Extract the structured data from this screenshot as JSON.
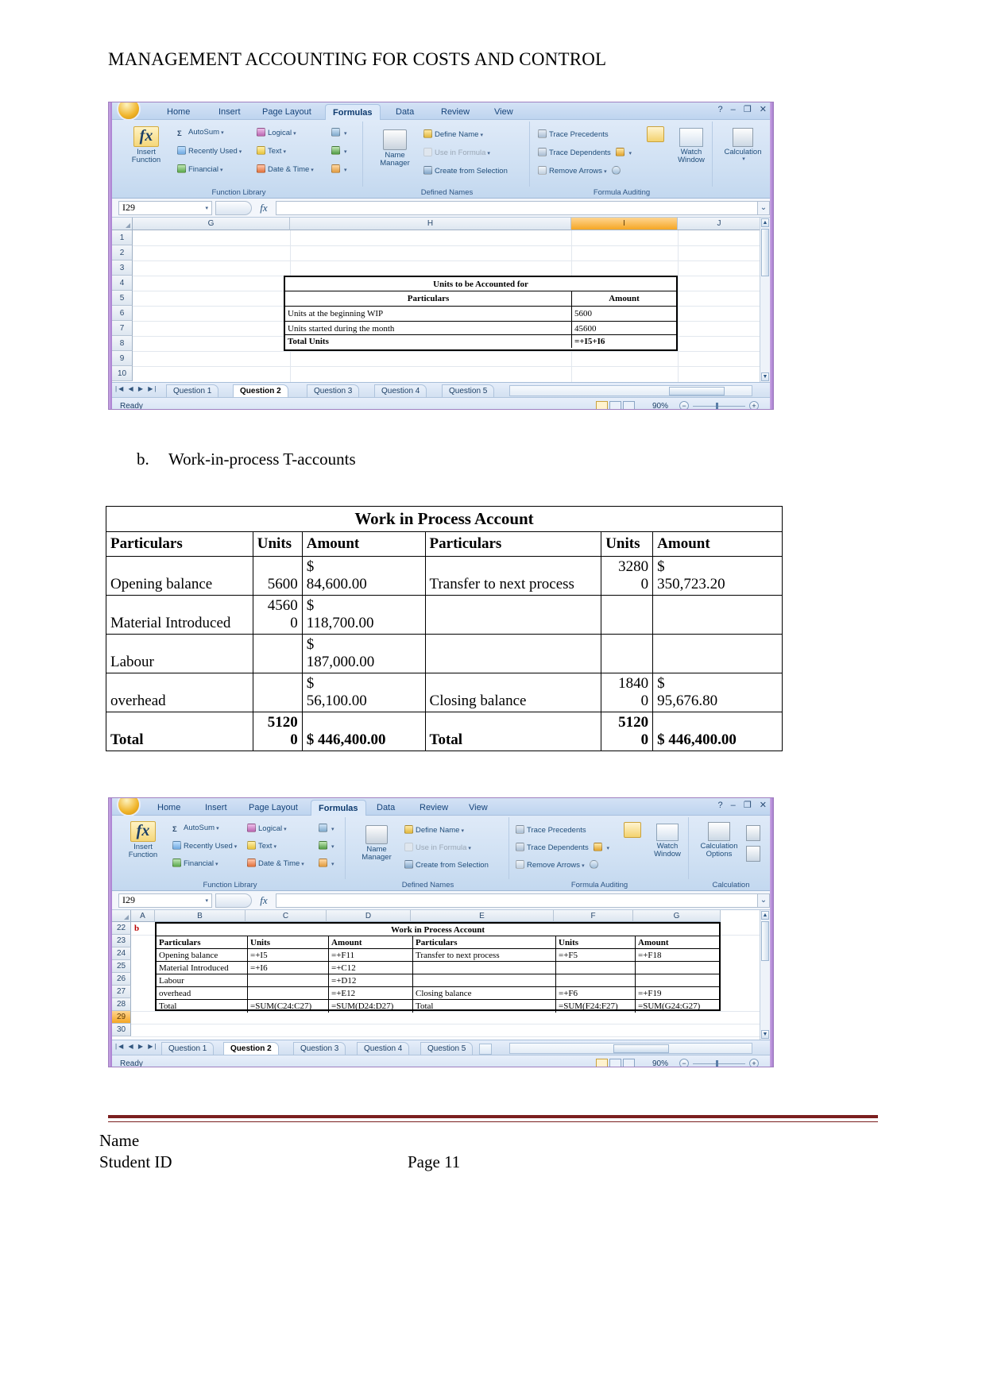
{
  "document": {
    "header": "MANAGEMENT ACCOUNTING FOR COSTS AND CONTROL",
    "list_item_b": {
      "marker": "b.",
      "text": "Work-in-process T-accounts"
    },
    "footer": {
      "name": "Name",
      "student_id": "Student ID",
      "page": "Page 11"
    }
  },
  "excel_top": {
    "ribbon_tabs": [
      "Home",
      "Insert",
      "Page Layout",
      "Formulas",
      "Data",
      "Review",
      "View"
    ],
    "active_ribbon_tab": "Formulas",
    "window_buttons": {
      "help": "?",
      "minimize": "–",
      "restore": "❐",
      "close": "✕"
    },
    "groups": {
      "function_library": {
        "label": "Function Library",
        "insert_function": "Insert\nFunction",
        "insert_function_line1": "Insert",
        "insert_function_line2": "Function",
        "fx": "fx",
        "items": [
          "AutoSum",
          "Recently Used",
          "Financial",
          "Logical",
          "Text",
          "Date & Time"
        ]
      },
      "defined_names": {
        "label": "Defined Names",
        "name_manager_line1": "Name",
        "name_manager_line2": "Manager",
        "items": [
          "Define Name",
          "Use in Formula",
          "Create from Selection"
        ]
      },
      "formula_auditing": {
        "label": "Formula Auditing",
        "items": [
          "Trace Precedents",
          "Trace Dependents",
          "Remove Arrows"
        ],
        "watch_window_line1": "Watch",
        "watch_window_line2": "Window"
      },
      "calculation": {
        "label": "Calculation",
        "calculation_line1": "Calculation"
      }
    },
    "name_box": "I29",
    "formula_bar_value": "",
    "columns": [
      "G",
      "H",
      "I",
      "J"
    ],
    "selected_column": "I",
    "rows": [
      "1",
      "2",
      "3",
      "4",
      "5",
      "6",
      "7",
      "8",
      "9",
      "10"
    ],
    "sheet_table": {
      "title": "Units to be Accounted for",
      "headers": [
        "Particulars",
        "Amount"
      ],
      "rows": [
        {
          "particulars": "Units at the beginning WIP",
          "amount": "5600"
        },
        {
          "particulars": "Units started during the month",
          "amount": "45600"
        },
        {
          "particulars": "Total Units",
          "amount": "=+I5+I6"
        }
      ]
    },
    "sheet_tabs": [
      "Question 1",
      "Question 2",
      "Question 3",
      "Question 4",
      "Question 5"
    ],
    "active_sheet": "Question 2",
    "status": "Ready",
    "zoom": "90%"
  },
  "wip_table": {
    "title": "Work in Process Account",
    "headers": [
      "Particulars",
      "Units",
      "Amount",
      "Particulars",
      "Units",
      "Amount"
    ],
    "rows": [
      {
        "left_particulars": "Opening  balance",
        "left_units": "5600",
        "left_amount_sym": "$",
        "left_amount": "84,600.00",
        "right_particulars": "Transfer to next process",
        "right_units": "32800",
        "right_amount_sym": "$",
        "right_amount": "350,723.20"
      },
      {
        "left_particulars": "Material Introduced",
        "left_units": "45600",
        "left_amount_sym": "$",
        "left_amount": "118,700.00",
        "right_particulars": "",
        "right_units": "",
        "right_amount_sym": "",
        "right_amount": ""
      },
      {
        "left_particulars": "Labour",
        "left_units": "",
        "left_amount_sym": "$",
        "left_amount": "187,000.00",
        "right_particulars": "",
        "right_units": "",
        "right_amount_sym": "",
        "right_amount": ""
      },
      {
        "left_particulars": "overhead",
        "left_units": "",
        "left_amount_sym": "$",
        "left_amount": "56,100.00",
        "right_particulars": "Closing balance",
        "right_units": "18400",
        "right_amount_sym": "$",
        "right_amount": "95,676.80"
      }
    ],
    "total_row": {
      "left_label": "Total",
      "left_units": "51200",
      "left_amount": "$    446,400.00",
      "right_label": "Total",
      "right_units": "51200",
      "right_amount": "$  446,400.00"
    }
  },
  "excel_bottom": {
    "ribbon_tabs": [
      "Home",
      "Insert",
      "Page Layout",
      "Formulas",
      "Data",
      "Review",
      "View"
    ],
    "active_ribbon_tab": "Formulas",
    "window_buttons": {
      "help": "?",
      "minimize": "–",
      "restore": "❐",
      "close": "✕"
    },
    "groups": {
      "function_library": {
        "label": "Function Library",
        "insert_function_line1": "Insert",
        "insert_function_line2": "Function",
        "fx": "fx",
        "items": [
          "AutoSum",
          "Recently Used",
          "Financial",
          "Logical",
          "Text",
          "Date & Time"
        ]
      },
      "defined_names": {
        "label": "Defined Names",
        "name_manager_line1": "Name",
        "name_manager_line2": "Manager",
        "items": [
          "Define Name",
          "Use in Formula",
          "Create from Selection"
        ]
      },
      "formula_auditing": {
        "label": "Formula Auditing",
        "items": [
          "Trace Precedents",
          "Trace Dependents",
          "Remove Arrows"
        ],
        "watch_window_line1": "Watch",
        "watch_window_line2": "Window"
      },
      "calculation": {
        "label": "Calculation",
        "calculation_line1": "Calculation",
        "calculation_line2": "Options"
      }
    },
    "name_box": "I29",
    "formula_bar_value": "",
    "columns": [
      "A",
      "B",
      "C",
      "D",
      "E",
      "F",
      "G"
    ],
    "rows": [
      "22",
      "23",
      "24",
      "25",
      "26",
      "27",
      "28",
      "29",
      "30"
    ],
    "selected_row": "29",
    "cell_a22": "b",
    "sheet_table": {
      "title": "Work in Process Account",
      "headers": [
        "Particulars",
        "Units",
        "Amount",
        "Particulars",
        "Units",
        "Amount"
      ],
      "rows": [
        {
          "r": "24",
          "b": "Opening  balance",
          "c": "=+I5",
          "d": "=+F11",
          "e": "Transfer to next process",
          "f": "=+F5",
          "g": "=+F18"
        },
        {
          "r": "25",
          "b": "Material Introduced",
          "c": "=+I6",
          "d": "=+C12",
          "e": "",
          "f": "",
          "g": ""
        },
        {
          "r": "26",
          "b": "Labour",
          "c": "",
          "d": "=+D12",
          "e": "",
          "f": "",
          "g": ""
        },
        {
          "r": "27",
          "b": "overhead",
          "c": "",
          "d": "=+E12",
          "e": "Closing balance",
          "f": "=+F6",
          "g": "=+F19"
        },
        {
          "r": "28",
          "b": "Total",
          "c": "=SUM(C24:C27)",
          "d": "=SUM(D24:D27)",
          "e": "Total",
          "f": "=SUM(F24:F27)",
          "g": "=SUM(G24:G27)"
        }
      ]
    },
    "sheet_tabs": [
      "Question 1",
      "Question 2",
      "Question 3",
      "Question 4",
      "Question 5"
    ],
    "active_sheet": "Question 2",
    "status": "Ready",
    "zoom": "90%"
  },
  "colors": {
    "window_border": "#9f7fbf",
    "ribbon_blue": "#cfe0f3",
    "selected_header": "#f5a623",
    "footer_rule": "#7b1f1f"
  }
}
